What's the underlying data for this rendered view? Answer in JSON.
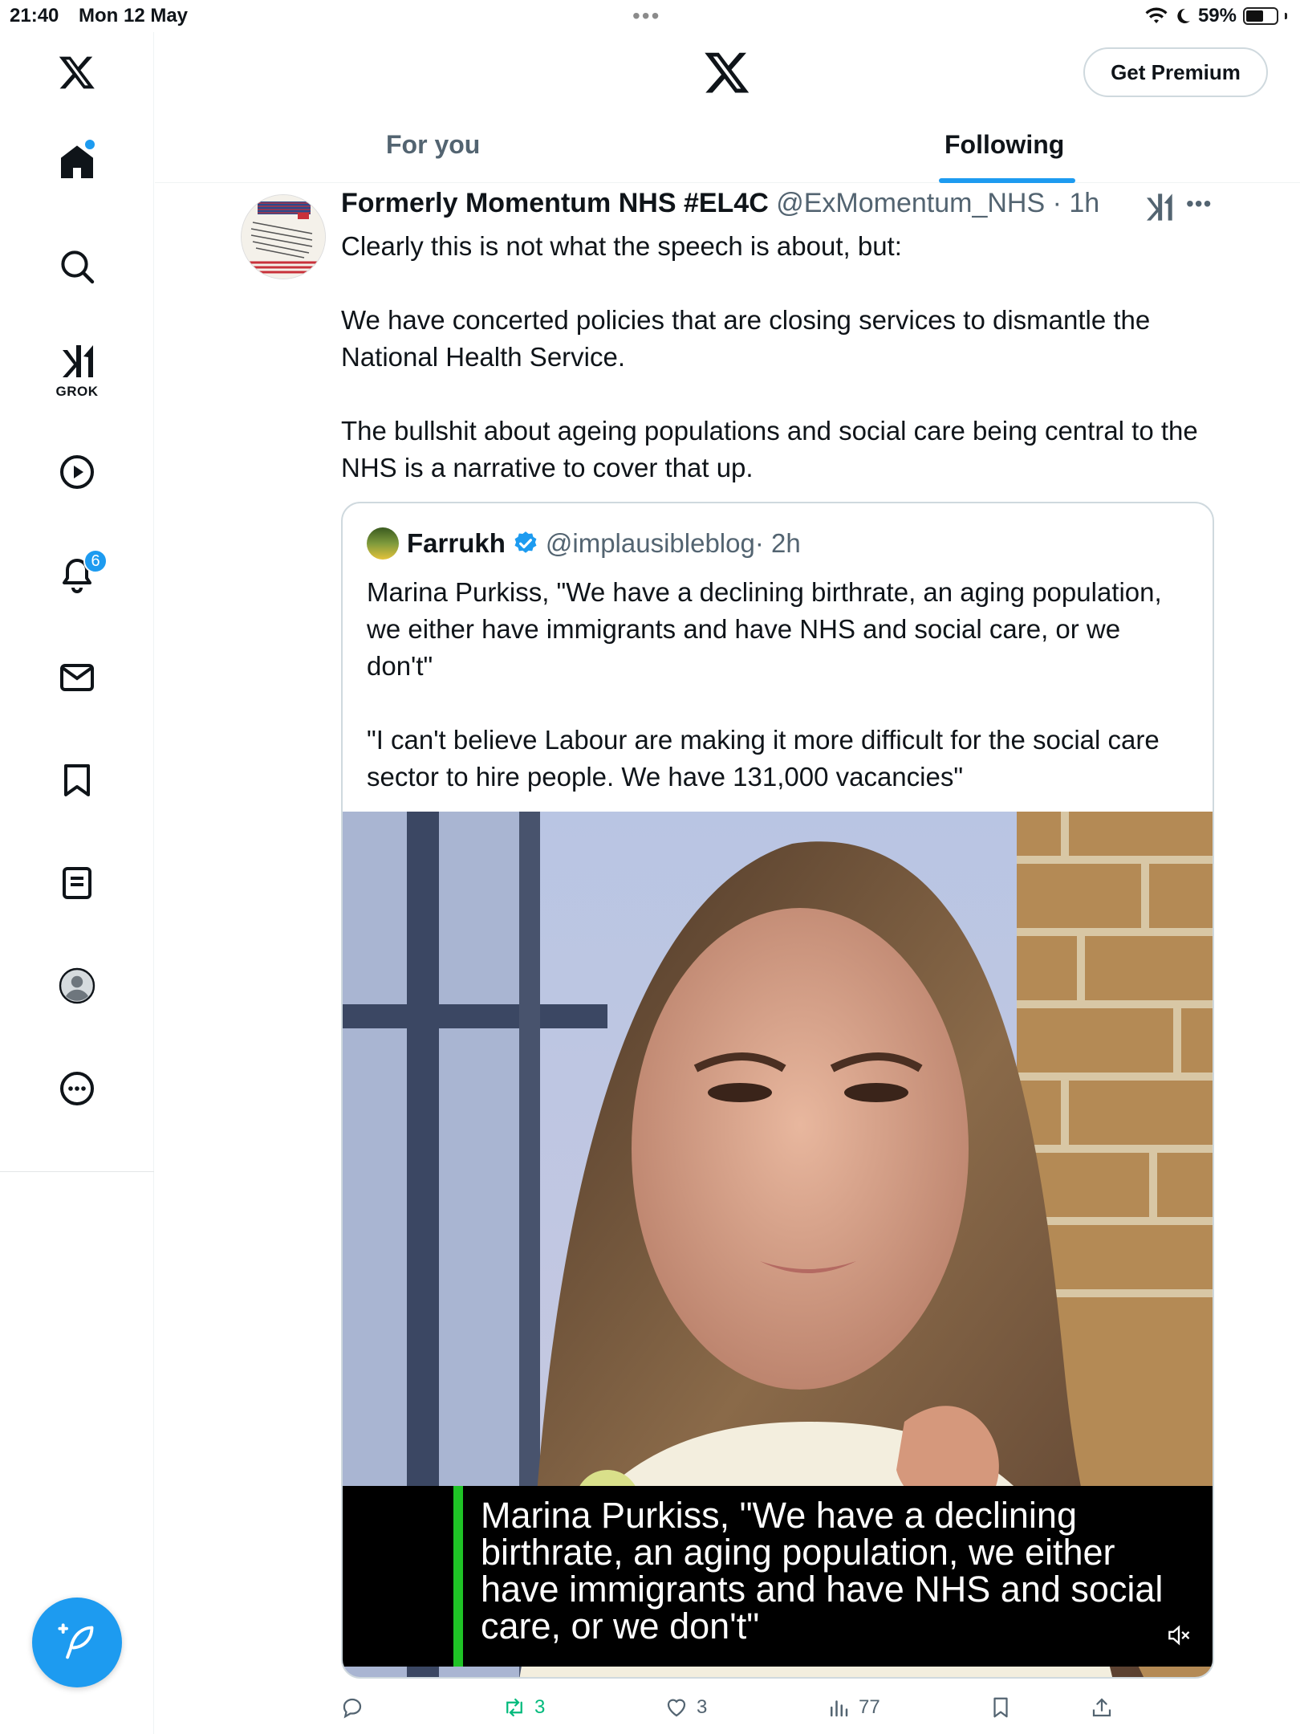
{
  "status_bar": {
    "time": "21:40",
    "date": "Mon 12 May",
    "battery_label": "59%",
    "battery_level": 0.59
  },
  "sidebar": {
    "grok_label": "GROK",
    "notifications_badge": "6",
    "items": [
      {
        "icon": "x-logo-icon"
      },
      {
        "icon": "home-icon"
      },
      {
        "icon": "search-icon"
      },
      {
        "icon": "grok-icon"
      },
      {
        "icon": "video-icon"
      },
      {
        "icon": "bell-icon"
      },
      {
        "icon": "mail-icon"
      },
      {
        "icon": "bookmark-icon"
      },
      {
        "icon": "list-icon"
      },
      {
        "icon": "profile-icon"
      },
      {
        "icon": "more-icon"
      }
    ]
  },
  "header": {
    "premium_label": "Get Premium",
    "tabs": [
      {
        "label": "For you",
        "active": false
      },
      {
        "label": "Following",
        "active": true
      }
    ]
  },
  "tweet": {
    "author_name": "Formerly Momentum NHS #EL4C",
    "handle": "@ExMomentum_NHS",
    "time": "· 1h",
    "text": "Clearly this is not what the speech is about, but:\n\nWe have concerted policies that are closing services to dismantle the National Health Service.\n\nThe bullshit about ageing populations and social care being central to the NHS is a narrative to cover that up.",
    "quote": {
      "author_name": "Farrukh",
      "handle": "@implausibleblog",
      "time": "· 2h",
      "text": "Marina Purkiss, \"We have a declining  birthrate, an aging population, we either have immigrants and have NHS and social care, or we don't\"\n\n\"I can't believe Labour are making it more difficult for the social care sector to hire people. We have 131,000 vacancies\"",
      "video_caption": "Marina Purkiss, \"We have a declining birthrate, an aging population, we either have immigrants and have NHS and social care, or we don't\""
    },
    "actions": {
      "reply_count": "",
      "retweet_count": "3",
      "like_count": "3",
      "views_count": "77"
    }
  },
  "colors": {
    "accent": "#1d9bf0",
    "retweet_green": "#00ba7c",
    "secondary_text": "#536471",
    "caption_green": "#1fc326"
  }
}
